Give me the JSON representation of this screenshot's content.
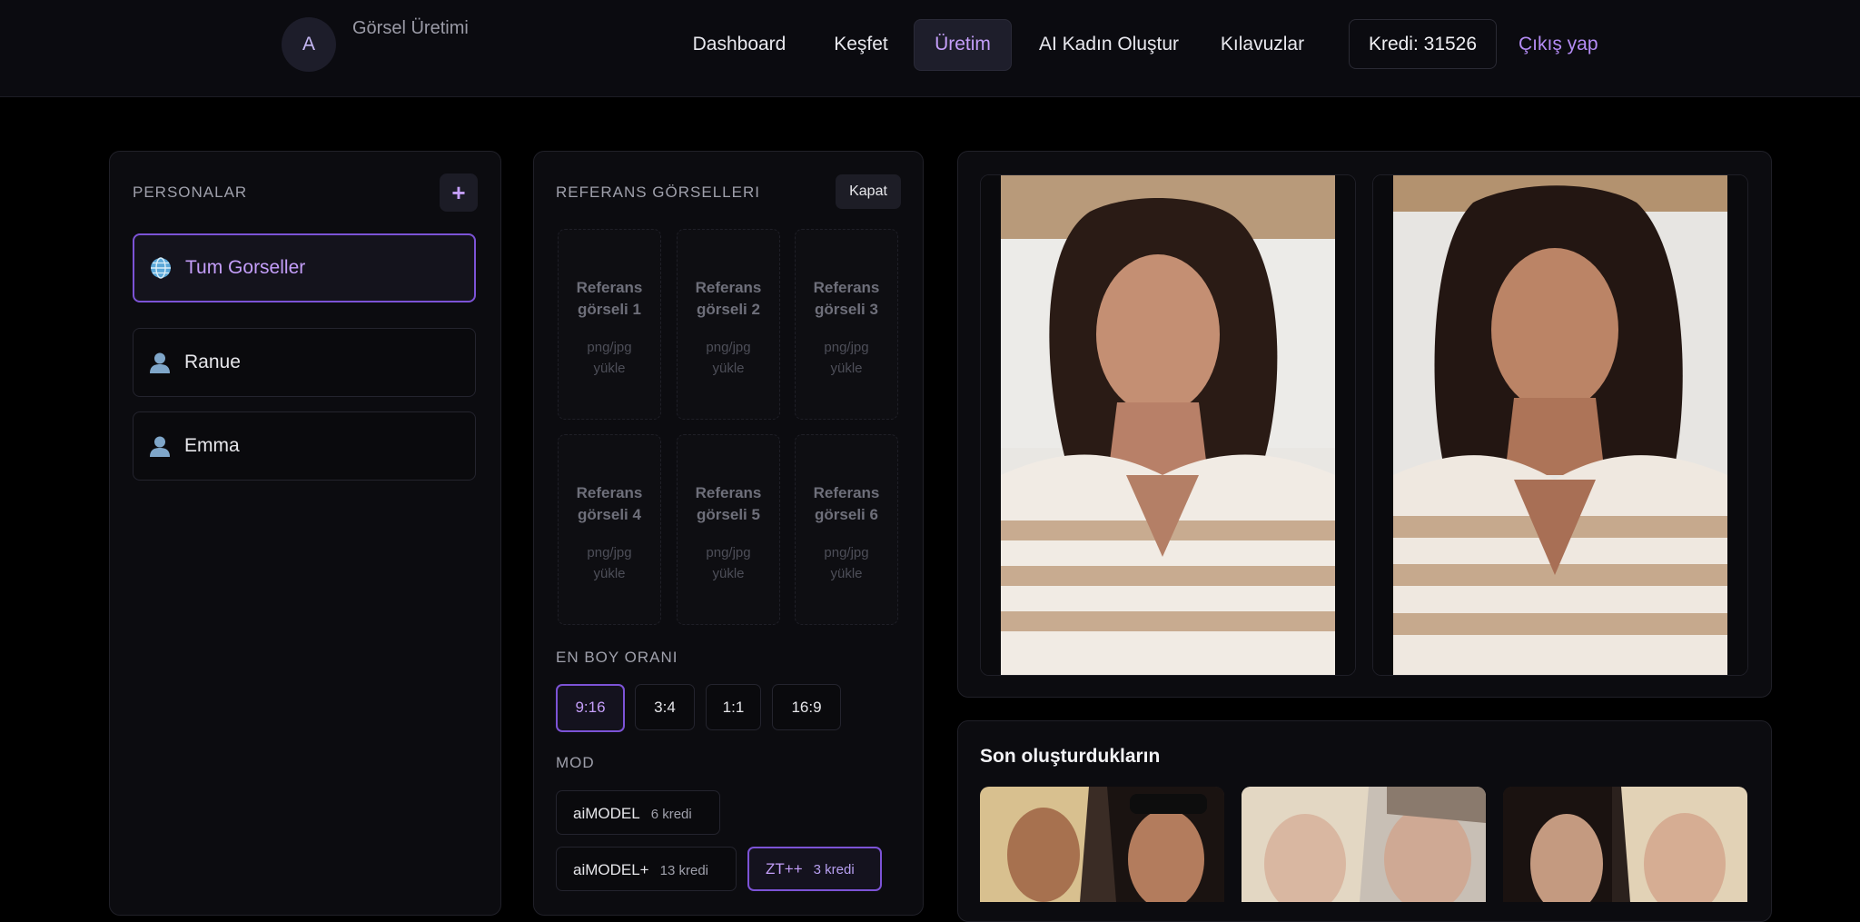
{
  "header": {
    "avatar_letter": "A",
    "title": "Görsel Üretimi",
    "nav": [
      {
        "label": "Dashboard",
        "active": false
      },
      {
        "label": "Keşfet",
        "active": false
      },
      {
        "label": "Üretim",
        "active": true
      },
      {
        "label": "AI Kadın Oluştur",
        "active": false
      },
      {
        "label": "Kılavuzlar",
        "active": false
      }
    ],
    "credit_label": "Kredi: 31526",
    "logout_label": "Çıkış yap"
  },
  "personas": {
    "heading": "PERSONALAR",
    "add_label": "+",
    "items": [
      {
        "label": "Tum Gorseller",
        "icon": "globe-icon",
        "active": true
      },
      {
        "label": "Ranue",
        "icon": "user-icon",
        "active": false
      },
      {
        "label": "Emma",
        "icon": "user-icon",
        "active": false
      }
    ]
  },
  "references": {
    "heading": "REFERANS GÖRSELLERI",
    "close_label": "Kapat",
    "slots": [
      {
        "title_line1": "Referans",
        "title_line2": "görseli 1",
        "sub_line1": "png/jpg",
        "sub_line2": "yükle"
      },
      {
        "title_line1": "Referans",
        "title_line2": "görseli 2",
        "sub_line1": "png/jpg",
        "sub_line2": "yükle"
      },
      {
        "title_line1": "Referans",
        "title_line2": "görseli 3",
        "sub_line1": "png/jpg",
        "sub_line2": "yükle"
      },
      {
        "title_line1": "Referans",
        "title_line2": "görseli 4",
        "sub_line1": "png/jpg",
        "sub_line2": "yükle"
      },
      {
        "title_line1": "Referans",
        "title_line2": "görseli 5",
        "sub_line1": "png/jpg",
        "sub_line2": "yükle"
      },
      {
        "title_line1": "Referans",
        "title_line2": "görseli 6",
        "sub_line1": "png/jpg",
        "sub_line2": "yükle"
      }
    ],
    "aspect_heading": "EN BOY ORANI",
    "aspect_options": [
      {
        "label": "9:16",
        "active": true
      },
      {
        "label": "3:4",
        "active": false
      },
      {
        "label": "1:1",
        "active": false
      },
      {
        "label": "16:9",
        "active": false
      }
    ],
    "mode_heading": "MOD",
    "modes": [
      {
        "name": "aiMODEL",
        "cost": "6 kredi",
        "active": false
      },
      {
        "name": "aiMODEL+",
        "cost": "13 kredi",
        "active": false
      },
      {
        "name": "ZT++",
        "cost": "3 kredi",
        "active": true
      }
    ]
  },
  "recent": {
    "title": "Son oluşturdukların"
  },
  "colors": {
    "accent": "#7c53d6",
    "accent_text": "#c49ef9",
    "logout": "#b48cf5",
    "panel_bg": "#0c0c10",
    "page_bg": "#000000"
  }
}
